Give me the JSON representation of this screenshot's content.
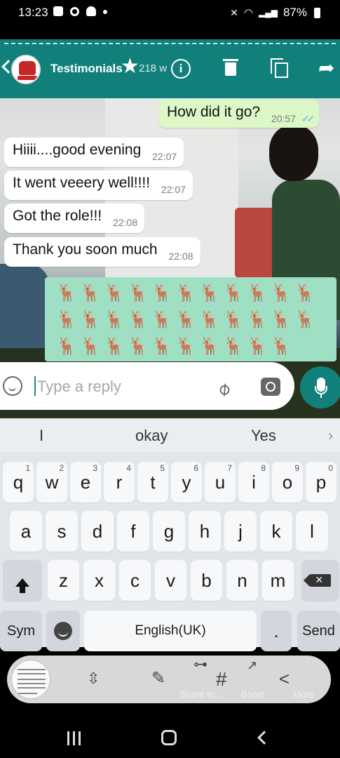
{
  "status_bar": {
    "time": "13:23",
    "battery_percent": "87%"
  },
  "chat_header": {
    "title": "Testimonials",
    "subtitle": "218 w",
    "actions": [
      "info-icon",
      "delete-icon",
      "copy-icon",
      "forward-icon"
    ]
  },
  "messages": [
    {
      "direction": "out",
      "text": "How did it go?",
      "time": "20:57",
      "status": "read"
    },
    {
      "direction": "in",
      "text": "Hiiii....good evening",
      "time": "22:07"
    },
    {
      "direction": "in",
      "text": "It went veeery well!!!!",
      "time": "22:07"
    },
    {
      "direction": "in",
      "text": "Got the role!!!",
      "time": "22:08"
    },
    {
      "direction": "in",
      "text": "Thank you soon much",
      "time": "22:08"
    }
  ],
  "emoji_message": {
    "emoji": "🦌",
    "rows": [
      11,
      11,
      10
    ]
  },
  "reply_bar": {
    "placeholder": "Type a reply"
  },
  "keyboard": {
    "suggestions": [
      "I",
      "okay",
      "Yes"
    ],
    "row1": [
      {
        "key": "q",
        "num": "1"
      },
      {
        "key": "w",
        "num": "2"
      },
      {
        "key": "e",
        "num": "3"
      },
      {
        "key": "r",
        "num": "4"
      },
      {
        "key": "t",
        "num": "5"
      },
      {
        "key": "y",
        "num": "6"
      },
      {
        "key": "u",
        "num": "7"
      },
      {
        "key": "i",
        "num": "8"
      },
      {
        "key": "o",
        "num": "9"
      },
      {
        "key": "p",
        "num": "0"
      }
    ],
    "row2": [
      "a",
      "s",
      "d",
      "f",
      "g",
      "h",
      "j",
      "k",
      "l"
    ],
    "row3": [
      "z",
      "x",
      "c",
      "v",
      "b",
      "n",
      "m"
    ],
    "sym_label": "Sym",
    "space_label": "English(UK)",
    "period_label": ".",
    "send_label": "Send"
  },
  "screenshot_toolbar": {
    "share_label": "Share to...",
    "boost_label": "Boost",
    "more_label": "More"
  },
  "colors": {
    "header_teal": "#11807a",
    "outgoing_bubble": "#dcf8c6",
    "incoming_bubble": "#ffffff",
    "emoji_bubble": "#9fe0c4",
    "read_ticks": "#4fb6ec"
  }
}
